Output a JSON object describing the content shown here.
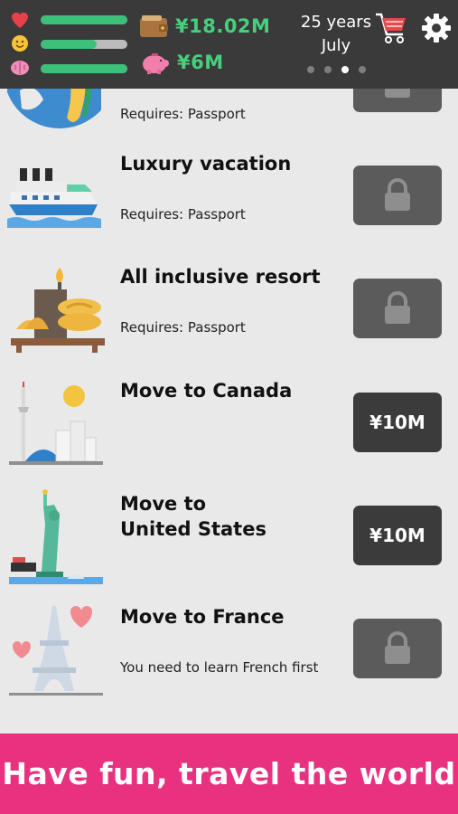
{
  "header": {
    "stats": [
      {
        "name": "health",
        "icon": "heart-icon",
        "level": 1.0
      },
      {
        "name": "happiness",
        "icon": "smiley-icon",
        "level": 0.65
      },
      {
        "name": "smarts",
        "icon": "brain-icon",
        "level": 1.0
      }
    ],
    "cash": {
      "icon": "wallet-icon",
      "value": "¥18.02M"
    },
    "savings": {
      "icon": "piggy-bank-icon",
      "value": "¥6M"
    },
    "age": "25 years",
    "month": "July",
    "page_dots": {
      "count": 4,
      "active_index": 2
    },
    "cart_icon": "shopping-cart-icon",
    "settings_icon": "gear-icon",
    "colors": {
      "bar_fill": "#3dc07a",
      "money": "#46d07e",
      "header_bg": "#3a3a3a"
    }
  },
  "items": [
    {
      "title": "",
      "requirement": "Requires: Passport",
      "locked": true,
      "icon": "globe-icon"
    },
    {
      "title": "Luxury vacation",
      "requirement": "Requires: Passport",
      "locked": true,
      "icon": "cruise-ship-icon"
    },
    {
      "title": "All inclusive resort",
      "requirement": "Requires: Passport",
      "locked": true,
      "icon": "resort-icon"
    },
    {
      "title": "Move to Canada",
      "requirement": "",
      "locked": false,
      "price": "¥10M",
      "icon": "toronto-skyline-icon"
    },
    {
      "title_line1": "Move to",
      "title_line2": "United States",
      "requirement": "",
      "locked": false,
      "price": "¥10M",
      "icon": "statue-of-liberty-icon"
    },
    {
      "title": "Move to France",
      "requirement": "You need to learn French first",
      "locked": true,
      "icon": "eiffel-tower-icon"
    }
  ],
  "banner": {
    "text": "Have fun, travel the world",
    "color": "#e8317f"
  }
}
